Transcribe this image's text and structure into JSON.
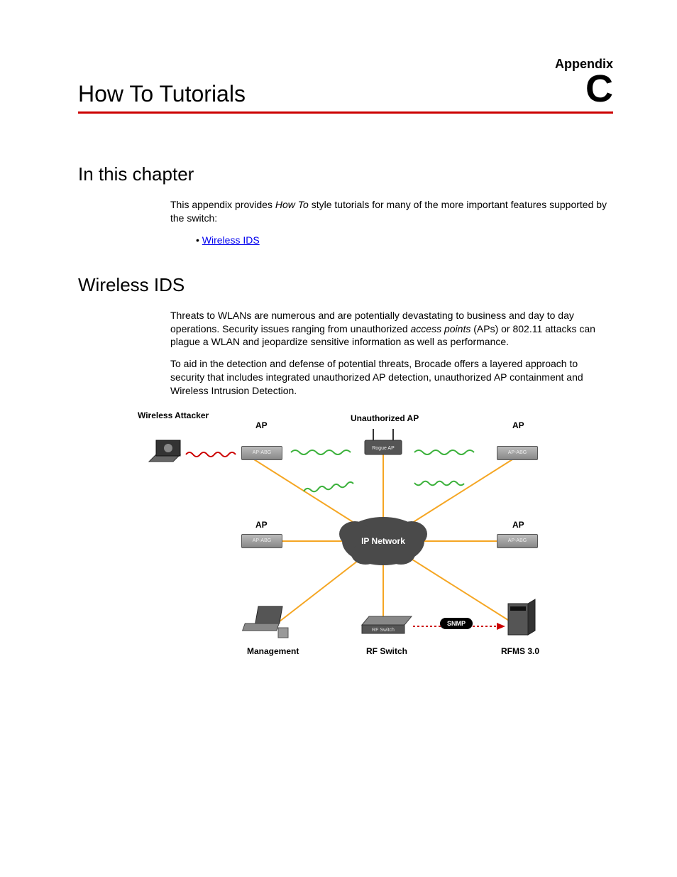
{
  "header": {
    "appendix_label": "Appendix",
    "title": "How To Tutorials",
    "letter": "C"
  },
  "sections": {
    "in_chapter": {
      "title": "In this chapter",
      "intro_pre": "This appendix provides ",
      "intro_em": "How To",
      "intro_post": " style tutorials for many of the more important features supported by the switch:",
      "bullets": [
        "Wireless IDS"
      ]
    },
    "wireless_ids": {
      "title": "Wireless IDS",
      "p1_pre": "Threats to WLANs are numerous and are potentially devastating to business and day to day operations. Security issues ranging from unauthorized ",
      "p1_em": "access points",
      "p1_post": " (APs) or 802.11 attacks can plague a WLAN and jeopardize sensitive information as well as performance.",
      "p2": "To aid in the detection and defense of potential threats, Brocade offers a layered approach to security that includes integrated unauthorized AP detection, unauthorized AP containment and Wireless Intrusion Detection."
    }
  },
  "diagram": {
    "wireless_attacker": "Wireless Attacker",
    "ap": "AP",
    "unauthorized_ap": "Unauthorized AP",
    "ip_network": "IP Network",
    "management": "Management",
    "rf_switch": "RF Switch",
    "rfms": "RFMS 3.0",
    "snmp": "SNMP",
    "rogue_ap": "Rogue AP",
    "ap_abg": "AP-ABG"
  }
}
